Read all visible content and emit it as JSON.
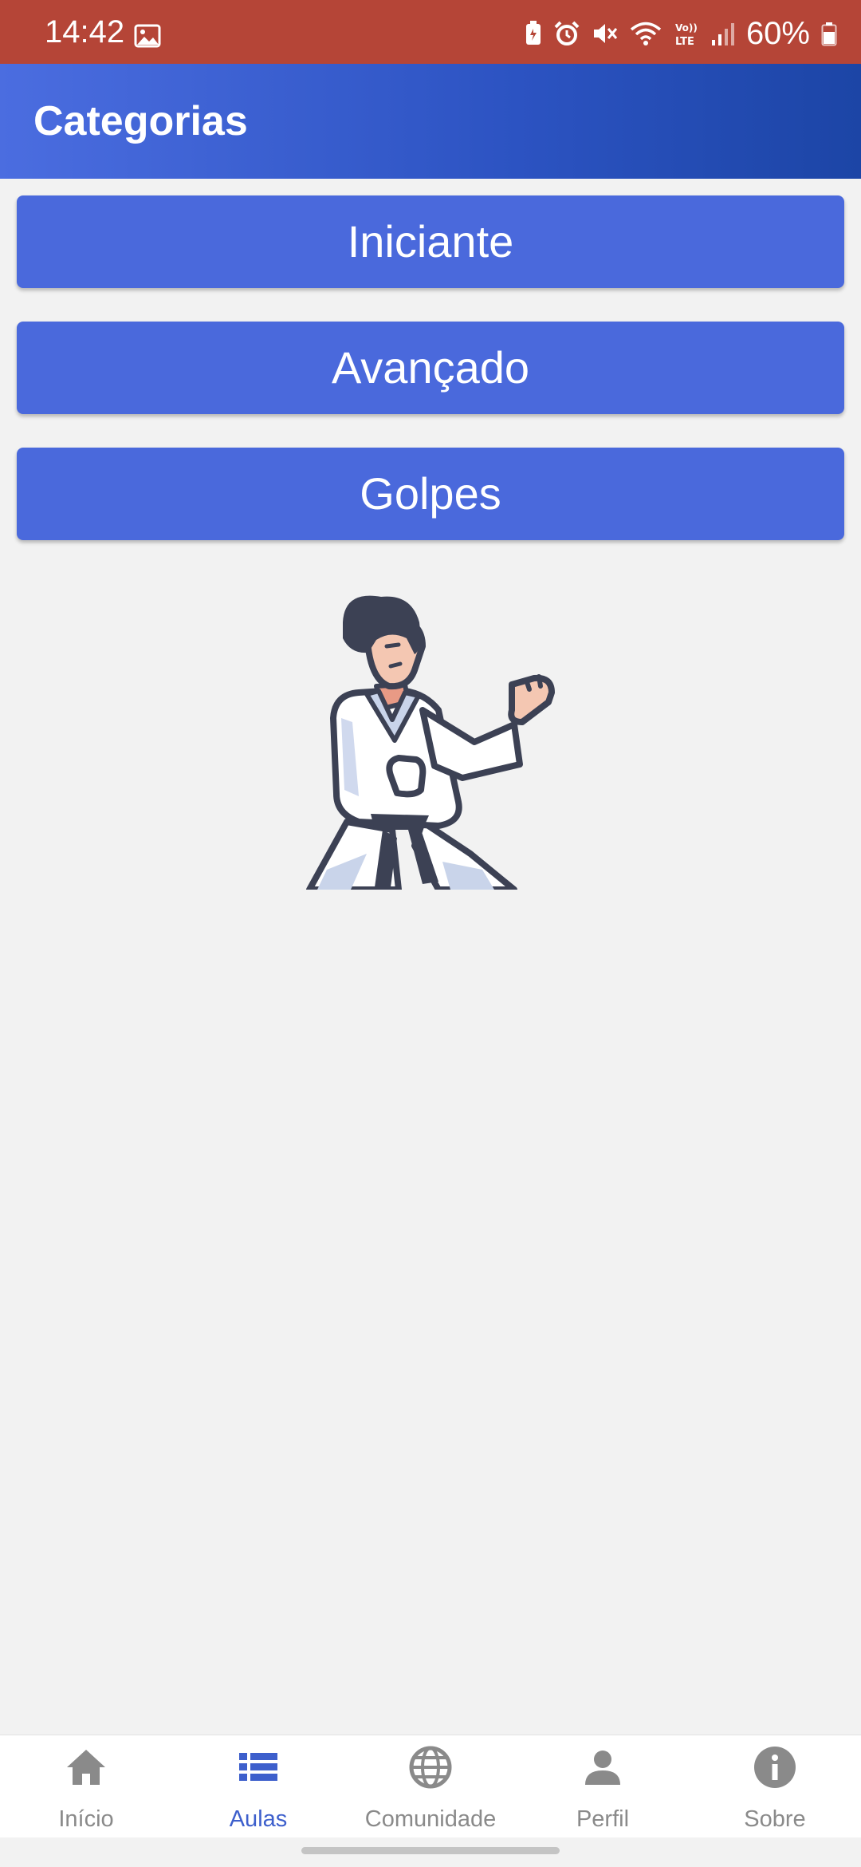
{
  "status_bar": {
    "time": "14:42",
    "battery": "60%",
    "icons": [
      "gallery-icon",
      "battery-saver-icon",
      "alarm-icon",
      "mute-icon",
      "wifi-icon",
      "volte-icon",
      "signal-icon",
      "battery-icon"
    ]
  },
  "app_bar": {
    "title": "Categorias"
  },
  "categories": [
    {
      "label": "Iniciante"
    },
    {
      "label": "Avançado"
    },
    {
      "label": "Golpes"
    }
  ],
  "illustration": {
    "name": "karate-figure"
  },
  "bottom_nav": {
    "active": "Aulas",
    "active_color": "#3d5fcc",
    "inactive_color": "#8a8a8a",
    "items": [
      {
        "label": "Início",
        "icon": "home-icon"
      },
      {
        "label": "Aulas",
        "icon": "list-icon"
      },
      {
        "label": "Comunidade",
        "icon": "globe-icon"
      },
      {
        "label": "Perfil",
        "icon": "person-icon"
      },
      {
        "label": "Sobre",
        "icon": "info-icon"
      }
    ]
  },
  "colors": {
    "status_bar": "#b54537",
    "app_bar_start": "#4b6de0",
    "app_bar_end": "#1c45a6",
    "button": "#4a69dc",
    "background": "#f2f2f2"
  }
}
